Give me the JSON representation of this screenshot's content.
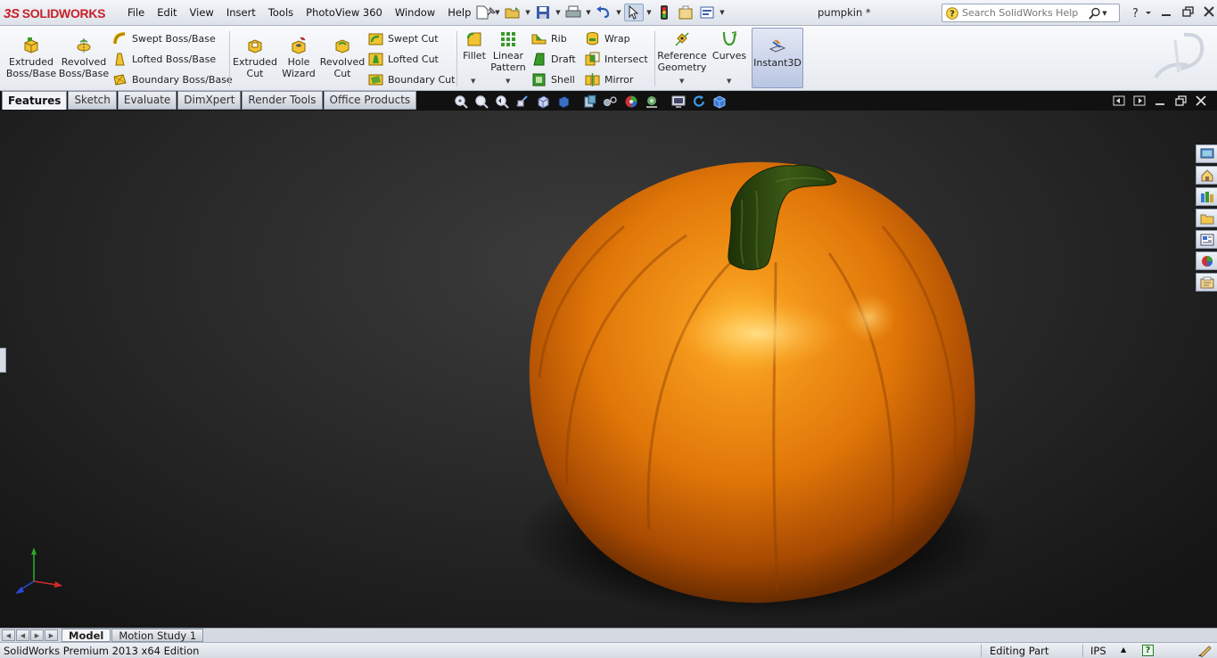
{
  "app": {
    "logo_text": "SOLIDWORKS",
    "logo_prefix": "3S",
    "document_title": "pumpkin *"
  },
  "menu": [
    "File",
    "Edit",
    "View",
    "Insert",
    "Tools",
    "PhotoView 360",
    "Window",
    "Help"
  ],
  "search": {
    "placeholder": "Search SolidWorks Help"
  },
  "ribbon": {
    "extruded_boss": "Extruded\nBoss/Base",
    "revolved_boss": "Revolved\nBoss/Base",
    "swept_boss": "Swept Boss/Base",
    "lofted_boss": "Lofted Boss/Base",
    "boundary_boss": "Boundary Boss/Base",
    "extruded_cut": "Extruded\nCut",
    "hole_wizard": "Hole\nWizard",
    "revolved_cut": "Revolved\nCut",
    "swept_cut": "Swept Cut",
    "lofted_cut": "Lofted Cut",
    "boundary_cut": "Boundary Cut",
    "fillet": "Fillet",
    "linear_pattern": "Linear\nPattern",
    "rib": "Rib",
    "draft": "Draft",
    "shell": "Shell",
    "wrap": "Wrap",
    "intersect": "Intersect",
    "mirror": "Mirror",
    "reference_geometry": "Reference\nGeometry",
    "curves": "Curves",
    "instant3d": "Instant3D"
  },
  "tabs": [
    {
      "label": "Features",
      "active": true
    },
    {
      "label": "Sketch",
      "active": false
    },
    {
      "label": "Evaluate",
      "active": false
    },
    {
      "label": "DimXpert",
      "active": false
    },
    {
      "label": "Render Tools",
      "active": false
    },
    {
      "label": "Office Products",
      "active": false
    }
  ],
  "bottom_tabs": [
    {
      "label": "Model",
      "active": true
    },
    {
      "label": "Motion Study 1",
      "active": false
    }
  ],
  "status": {
    "edition": "SolidWorks Premium 2013 x64 Edition",
    "mode": "Editing Part",
    "units": "IPS",
    "help": "?"
  },
  "colors": {
    "pumpkin": "#e8780a",
    "stem": "#2f4a12",
    "viewport_bg": "#2a2a2a",
    "logo_red": "#c8202a"
  }
}
